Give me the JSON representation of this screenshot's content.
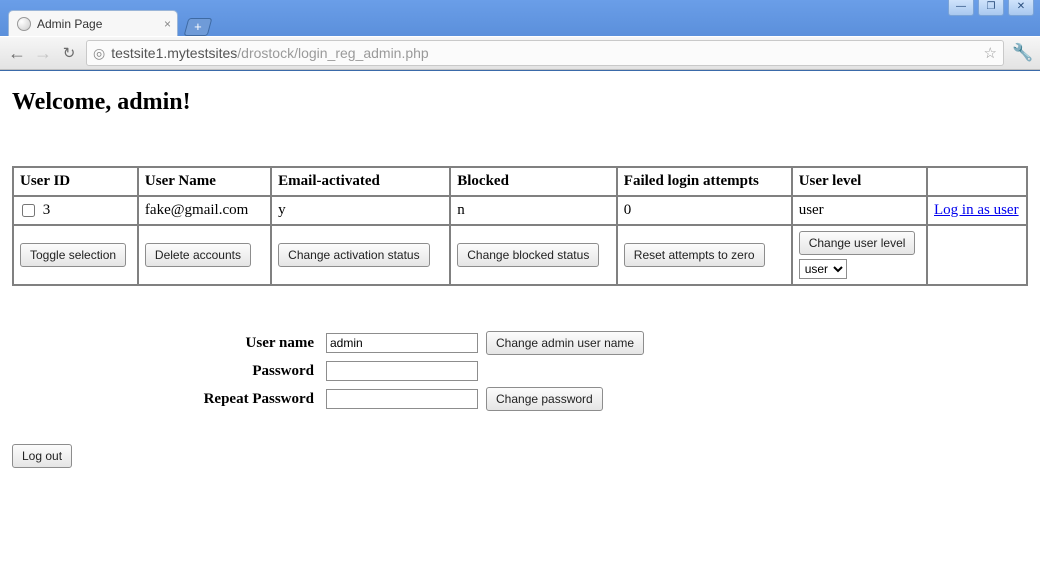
{
  "chrome": {
    "tab_title": "Admin Page",
    "url_host": "testsite1.mytestsites",
    "url_path": "/drostock/login_reg_admin.php",
    "win_min": "—",
    "win_max": "❐",
    "win_close": "✕",
    "new_tab_glyph": "+",
    "tab_close_glyph": "×",
    "globe_glyph": "◎",
    "star_glyph": "☆",
    "wrench_glyph": "🔧",
    "back_glyph": "←",
    "forward_glyph": "→",
    "reload_glyph": "↻"
  },
  "page": {
    "heading": "Welcome, admin!"
  },
  "grid": {
    "headers": {
      "user_id": "User ID",
      "user_name": "User Name",
      "email_activated": "Email-activated",
      "blocked": "Blocked",
      "failed_attempts": "Failed login attempts",
      "user_level": "User level"
    },
    "rows": [
      {
        "id": "3",
        "user_name": "fake@gmail.com",
        "email_activated": "y",
        "blocked": "n",
        "failed_attempts": "0",
        "user_level": "user",
        "login_as_label": "Log in as user"
      }
    ],
    "actions": {
      "toggle_selection": "Toggle selection",
      "delete_accounts": "Delete accounts",
      "change_activation": "Change activation status",
      "change_blocked": "Change blocked status",
      "reset_attempts": "Reset attempts to zero",
      "change_user_level": "Change user level",
      "level_options": [
        "user"
      ],
      "level_selected": "user"
    }
  },
  "credentials": {
    "user_name_label": "User name",
    "user_name_value": "admin",
    "password_label": "Password",
    "repeat_password_label": "Repeat Password",
    "change_username_btn": "Change admin user name",
    "change_password_btn": "Change password"
  },
  "logout": {
    "label": "Log out"
  }
}
